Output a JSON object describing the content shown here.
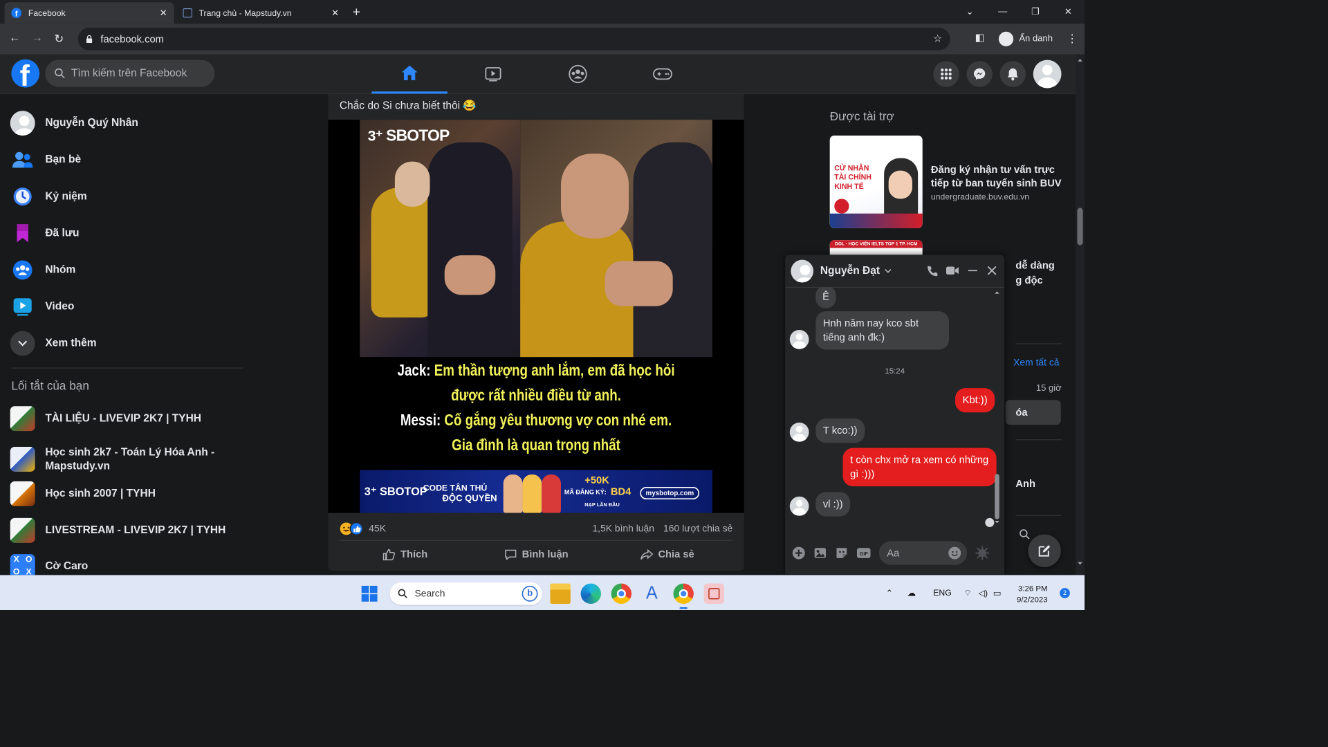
{
  "browser": {
    "tabs": [
      {
        "title": "Facebook",
        "active": true
      },
      {
        "title": "Trang chủ - Mapstudy.vn",
        "active": false
      }
    ],
    "url": "facebook.com",
    "profile_label": "Ẩn danh"
  },
  "header": {
    "search_placeholder": "Tìm kiếm trên Facebook"
  },
  "sidebar": {
    "items": [
      {
        "label": "Nguyễn Quý Nhân",
        "icon": "avatar"
      },
      {
        "label": "Bạn bè",
        "icon": "friends-icon"
      },
      {
        "label": "Kỷ niệm",
        "icon": "memories-icon"
      },
      {
        "label": "Đã lưu",
        "icon": "saved-icon"
      },
      {
        "label": "Nhóm",
        "icon": "groups-icon"
      },
      {
        "label": "Video",
        "icon": "video-icon"
      },
      {
        "label": "Xem thêm",
        "icon": "chevron-down-icon"
      }
    ],
    "shortcuts_title": "Lối tắt của bạn",
    "shortcuts": [
      {
        "label": "TÀI LIỆU - LIVEVIP 2K7 | TYHH"
      },
      {
        "label": "Học sinh 2k7 - Toán Lý Hóa Anh - Mapstudy.vn"
      },
      {
        "label": "Học sinh 2007 | TYHH"
      },
      {
        "label": "LIVESTREAM - LIVEVIP 2K7 | TYHH"
      },
      {
        "label": "Cờ Caro"
      }
    ]
  },
  "post": {
    "caption": "Chắc do Si chưa biết thôi 😂",
    "image": {
      "watermark": "SBOTOP",
      "lines": [
        {
          "speaker": "Jack:",
          "text": "Em thần tượng anh lắm, em đã học hỏi"
        },
        {
          "speaker": "",
          "text": "được rất nhiều điều từ anh."
        },
        {
          "speaker": "Messi:",
          "text": "Cố gắng yêu thương vợ con nhé em."
        },
        {
          "speaker": "",
          "text": "Gia đình là quan trọng nhất"
        }
      ],
      "banner": {
        "brand": "SBOTOP",
        "promo_line1": "CODE TÂN THỦ",
        "promo_line2": "ĐỘC QUYỀN",
        "bonus": "+50K",
        "code_label": "MÃ ĐĂNG KÝ:",
        "code": "BD4",
        "site": "mysbotop.com",
        "note": "NẠP LẦN ĐẦU"
      }
    },
    "reactions_count": "45K",
    "comments": "1,5K bình luận",
    "shares": "160 lượt chia sẻ",
    "actions": {
      "like": "Thích",
      "comment": "Bình luận",
      "share": "Chia sẻ"
    }
  },
  "right": {
    "sponsored_title": "Được tài trợ",
    "ad1": {
      "title": "Đăng ký nhận tư vấn trực tiếp từ ban tuyển sinh BUV",
      "url": "undergraduate.buv.edu.vn",
      "image_text": "CỬ NHÂN TÀI CHÍNH KINH TẾ"
    },
    "ad2": {
      "image_text": "DOL - HỌC VIỆN IELTS TOP 1 TP. HCM",
      "title_fragment_1": "dễ dàng",
      "title_fragment_2": "g độc"
    },
    "partial": {
      "see_all": "Xem tất cả",
      "time": "15 giờ",
      "f1": "óa",
      "f2": "Anh"
    }
  },
  "chat": {
    "contact": "Nguyễn Đạt",
    "messages": [
      {
        "from": "them",
        "text": "Ê"
      },
      {
        "from": "them",
        "text": "Hnh năm nay kco sbt tiếng anh đk:)"
      },
      {
        "from": "time",
        "text": "15:24"
      },
      {
        "from": "me",
        "text": "Kbt:))"
      },
      {
        "from": "them",
        "text": "T kco:))"
      },
      {
        "from": "me",
        "text": "t còn chx mở ra xem có những gì :)))"
      },
      {
        "from": "them",
        "text": "vl :))"
      }
    ],
    "input_placeholder": "Aa"
  },
  "taskbar": {
    "search": "Search",
    "lang": "ENG",
    "time": "3:26 PM",
    "date": "9/2/2023",
    "notif_count": "2"
  },
  "colors": {
    "fb_blue": "#1877f2",
    "accent_blue": "#2d88ff",
    "bubble_out": "#e41e1e",
    "bg": "#18191a",
    "surface": "#242526"
  }
}
